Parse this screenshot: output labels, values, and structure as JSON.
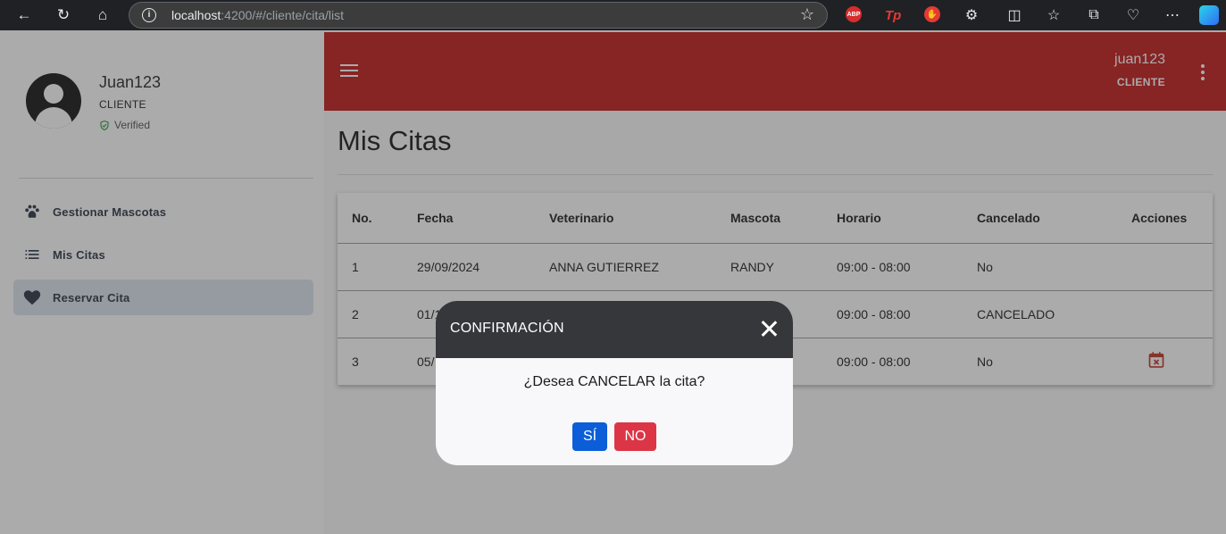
{
  "browser": {
    "url_host": "localhost",
    "url_rest": ":4200/#/cliente/cita/list",
    "extensions": [
      "ABP",
      "Tp"
    ]
  },
  "sidebar": {
    "user_name": "Juan123",
    "user_role": "CLIENTE",
    "verified": "Verified",
    "items": [
      {
        "label": "Gestionar Mascotas",
        "icon": "paw-icon"
      },
      {
        "label": "Mis Citas",
        "icon": "list-icon"
      },
      {
        "label": "Reservar Cita",
        "icon": "heart-icon"
      }
    ]
  },
  "topbar": {
    "user_name": "juan123",
    "user_role": "CLIENTE"
  },
  "main": {
    "title": "Mis Citas",
    "table": {
      "headers": [
        "No.",
        "Fecha",
        "Veterinario",
        "Mascota",
        "Horario",
        "Cancelado",
        "Acciones"
      ],
      "rows": [
        [
          "1",
          "29/09/2024",
          "ANNA GUTIERREZ",
          "RANDY",
          "09:00 - 08:00",
          "No"
        ],
        [
          "2",
          "01/1",
          "",
          "",
          "09:00 - 08:00",
          "CANCELADO"
        ],
        [
          "3",
          "05/",
          "",
          "",
          "09:00 - 08:00",
          "No"
        ]
      ]
    }
  },
  "dialog": {
    "title": "CONFIRMACIÓN",
    "message": "¿Desea CANCELAR la cita?",
    "yes_label": "SÍ",
    "no_label": "NO"
  },
  "colors": {
    "topbar": "#c41e1e",
    "dialog_header": "#35373b",
    "yes_button": "#0b5ed7",
    "no_button": "#dc3545"
  }
}
